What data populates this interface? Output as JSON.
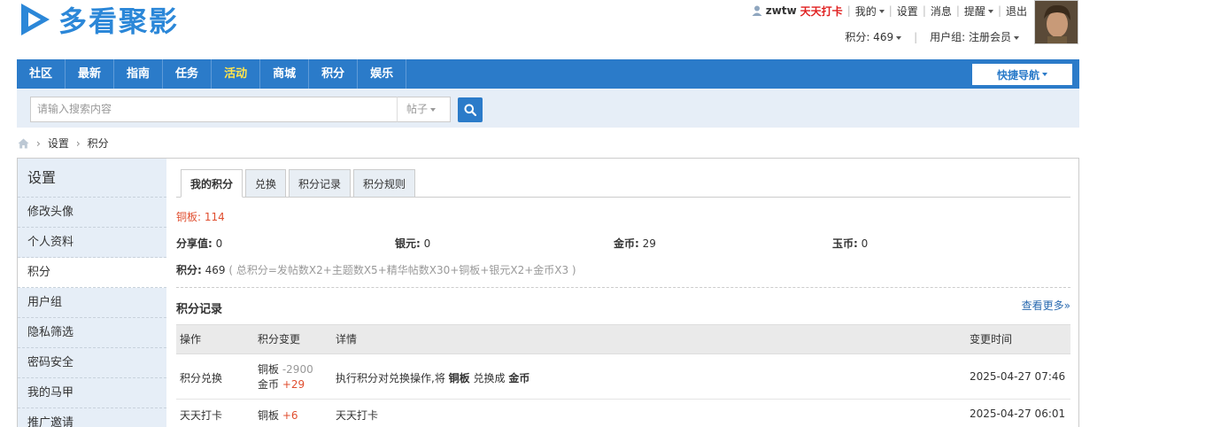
{
  "brand": {
    "logo_text": "多看聚影"
  },
  "topbar": {
    "username": "zwtw",
    "checkin": "天天打卡",
    "my": "我的",
    "settings": "设置",
    "messages": "消息",
    "reminders": "提醒",
    "logout": "退出",
    "points": "积分: 469",
    "usergroup": "用户组: 注册会员"
  },
  "nav": {
    "items": [
      "社区",
      "最新",
      "指南",
      "任务",
      "活动",
      "商城",
      "积分",
      "娱乐"
    ],
    "active_index": 4,
    "quick_nav": "快捷导航"
  },
  "search": {
    "placeholder": "请输入搜索内容",
    "type": "帖子"
  },
  "breadcrumb": [
    "设置",
    "积分"
  ],
  "sidebar": {
    "title": "设置",
    "items": [
      "修改头像",
      "个人资料",
      "积分",
      "用户组",
      "隐私筛选",
      "密码安全",
      "我的马甲",
      "推广邀请"
    ],
    "active_index": 2
  },
  "tabs": [
    "我的积分",
    "兑换",
    "积分记录",
    "积分规则"
  ],
  "credits": {
    "copper": "铜板: 114",
    "share_label": "分享值:",
    "share_value": "0",
    "silver_label": "银元:",
    "silver_value": "0",
    "gold_label": "金币:",
    "gold_value": "29",
    "jade_label": "玉币:",
    "jade_value": "0",
    "total_label": "积分:",
    "total_value": "469",
    "total_note": "( 总积分=发帖数X2+主题数X5+精华帖数X30+铜板+银元X2+金币X3 )"
  },
  "records": {
    "title": "积分记录",
    "more": "查看更多»",
    "columns": [
      "操作",
      "积分变更",
      "详情",
      "变更时间"
    ],
    "rows": [
      {
        "action": "积分兑换",
        "change1_name": "铜板",
        "change1_value": "-2900",
        "change2_name": "金币",
        "change2_value": "+29",
        "detail_pre": "执行积分对兑换操作,将",
        "detail_from": "铜板",
        "detail_mid": "兑换成",
        "detail_to": "金币",
        "time": "2025-04-27 07:46"
      },
      {
        "action": "天天打卡",
        "change1_name": "铜板",
        "change1_value": "+6",
        "detail": "天天打卡",
        "time": "2025-04-27 06:01"
      }
    ]
  },
  "colors": {
    "brand_blue": "#2b7bc9",
    "active_nav": "#ffe44d",
    "accent_red": "#e04e2f"
  }
}
